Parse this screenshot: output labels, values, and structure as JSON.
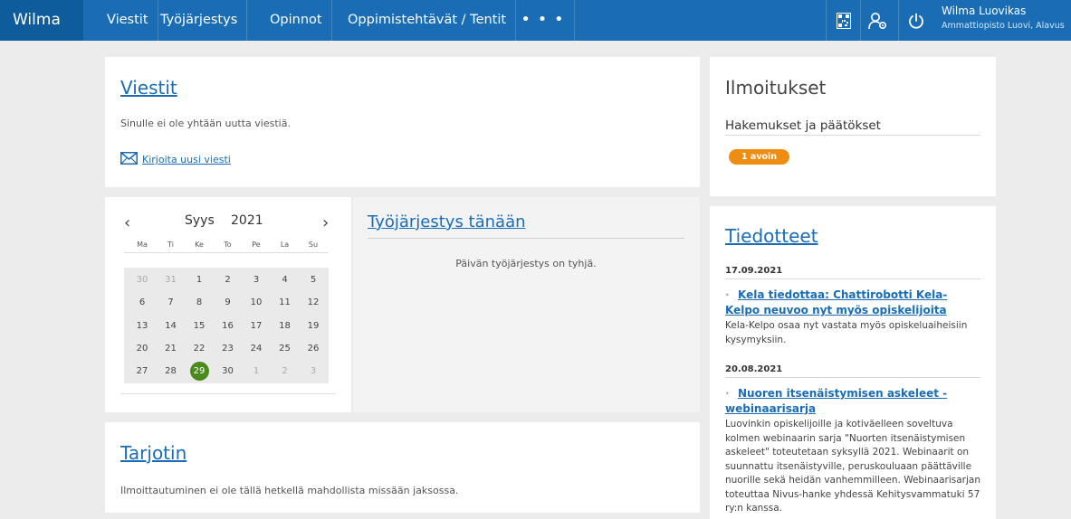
{
  "nav": {
    "brand": "Wilma",
    "items": [
      "Viestit",
      "Työjärjestys",
      "Opinnot",
      "Oppimistehtävät / Tentit"
    ],
    "more": "• • •",
    "user_name": "Wilma Luovikas",
    "user_school": "Ammattiopisto Luovi, Alavus"
  },
  "icons": [
    "qr-code-icon",
    "user-settings-icon",
    "power-icon"
  ],
  "messages": {
    "title": "Viestit",
    "empty_text": "Sinulle ei ole yhtään uutta viestiä.",
    "write_link": "Kirjoita uusi viesti"
  },
  "calendar": {
    "prev": "‹",
    "next": "›",
    "month": "Syys",
    "year": "2021",
    "weekdays": [
      "Ma",
      "Ti",
      "Ke",
      "To",
      "Pe",
      "La",
      "Su"
    ],
    "weeks": [
      [
        "30",
        "31",
        "1",
        "2",
        "3",
        "4",
        "5"
      ],
      [
        "6",
        "7",
        "8",
        "9",
        "10",
        "11",
        "12"
      ],
      [
        "13",
        "14",
        "15",
        "16",
        "17",
        "18",
        "19"
      ],
      [
        "20",
        "21",
        "22",
        "23",
        "24",
        "25",
        "26"
      ],
      [
        "27",
        "28",
        "29",
        "30",
        "1",
        "2",
        "3"
      ]
    ],
    "today": "29"
  },
  "schedule": {
    "title": "Työjärjestys tänään",
    "empty_text": "Päivän työjärjestys on tyhjä."
  },
  "tray": {
    "title": "Tarjotin",
    "text": "Ilmoittautuminen ei ole tällä hetkellä mahdollista missään jaksossa."
  },
  "notices": {
    "title": "Ilmoitukset",
    "subtitle": "Hakemukset ja päätökset",
    "badge": "1 avoin"
  },
  "news": {
    "title": "Tiedotteet",
    "items": [
      {
        "date": "17.09.2021",
        "title": "Kela tiedottaa: Chattirobotti Kela-Kelpo neuvoo nyt myös opiskelijoita",
        "body": "Kela-Kelpo osaa nyt vastata myös opiskeluaiheisiin kysymyksiin."
      },
      {
        "date": "20.08.2021",
        "title": "Nuoren itsenäistymisen askeleet - webinaarisarja",
        "body": "Luovinkin opiskelijoille ja kotiväelleen soveltuva kolmen webinaarin sarja \"Nuorten itsenäistymisen askeleet\" toteutetaan syksyllä 2021. Webinaarit on suunnattu itsenäistyville, peruskouluaan päättäville nuorille sekä heidän vanhemmilleen. Webinaarisarjan toteuttaa Nivus-hanke yhdessä Kehitysvammatuki 57 ry:n kanssa."
      }
    ]
  }
}
